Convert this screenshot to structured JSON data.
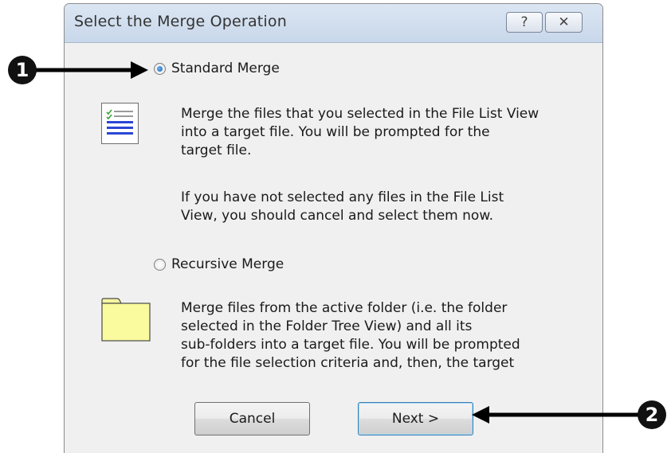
{
  "dialog": {
    "title": "Select the Merge Operation",
    "help_label": "?",
    "close_label": "✕"
  },
  "standard": {
    "label": "Standard Merge",
    "selected": true,
    "icon": "list-document-icon",
    "desc1": [
      "Merge the files that you selected in the File List View",
      "into a target file.  You will be prompted for the",
      "target file."
    ],
    "desc2": [
      "If you have not selected any files in the File List",
      "View, you should cancel and select them now."
    ]
  },
  "recursive": {
    "label": "Recursive Merge",
    "selected": false,
    "icon": "folder-icon",
    "desc": [
      "Merge files from the active folder (i.e. the folder",
      "selected in the Folder Tree View) and all its",
      "sub-folders into a target file.  You will be prompted",
      "for the file selection criteria and, then, the target"
    ]
  },
  "buttons": {
    "cancel": "Cancel",
    "next": "Next >"
  },
  "callouts": {
    "one": "1",
    "two": "2"
  },
  "colors": {
    "titlebar": "#c8d7ea",
    "dialog_bg": "#f0f0f0",
    "folder": "#fafa9e",
    "list_lines": "#2b46d6"
  }
}
